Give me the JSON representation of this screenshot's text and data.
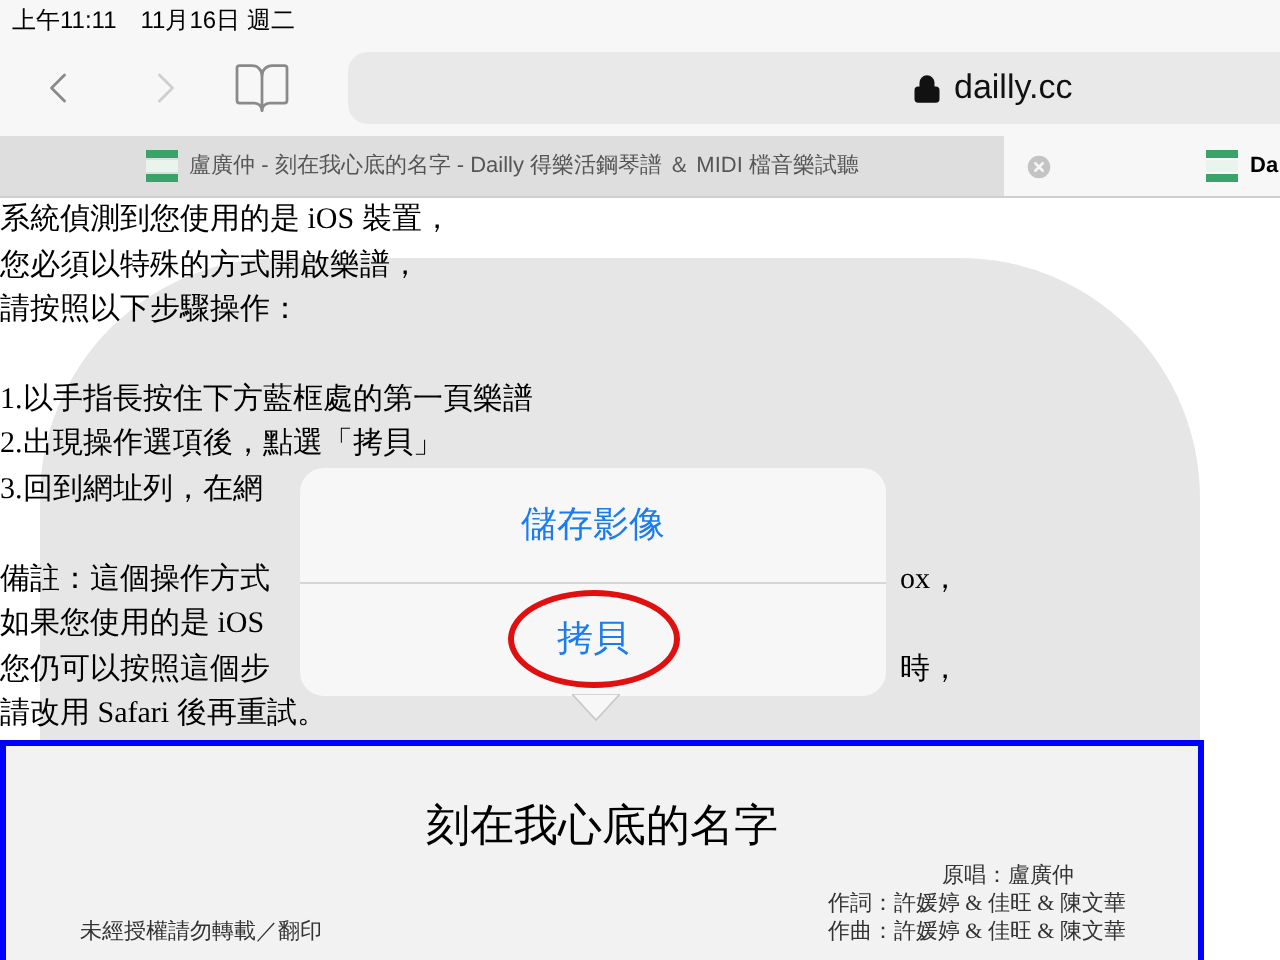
{
  "status_bar": {
    "time": "上午11:11",
    "date": "11月16日 週二"
  },
  "toolbar": {
    "back_disabled": false,
    "forward_disabled": true,
    "url": "dailly.cc"
  },
  "tabs": [
    {
      "title": "盧廣仲 - 刻在我心底的名字 - Dailly 得樂活鋼琴譜 ＆ MIDI 檔音樂試聽",
      "selected": false,
      "closable": false
    },
    {
      "title": "Da",
      "selected": true,
      "closable": true
    }
  ],
  "content": {
    "paragraphs": [
      [
        {
          "left": "系統偵測到您使用的是 iOS 裝置，"
        },
        {
          "left": "您必須以特殊的方式開啟樂譜，"
        },
        {
          "left": "請按照以下步驟操作："
        }
      ],
      [
        {
          "left": "1.以手指長按住下方藍框處的第一頁樂譜"
        },
        {
          "left": "2.出現操作選項後，點選「拷貝」"
        },
        {
          "left": "3.回到網址列，在網"
        }
      ],
      [
        {
          "left": "備註：這個操作方式",
          "right": "ox，"
        },
        {
          "left": "如果您使用的是 iOS"
        },
        {
          "left": "您仍可以按照這個步",
          "right": "時，"
        },
        {
          "left": "請改用 Safari 後再重試。"
        }
      ]
    ],
    "sheet": {
      "title": "刻在我心底的名字",
      "notice": "未經授權請勿轉載／翻印",
      "credits": [
        "原唱：盧廣仲",
        "作詞：許媛婷 & 佳旺 & 陳文華",
        "作曲：許媛婷 & 佳旺 & 陳文華"
      ]
    }
  },
  "menu": {
    "items": [
      {
        "label": "儲存影像",
        "circled": false
      },
      {
        "label": "拷貝",
        "circled": true
      }
    ]
  }
}
